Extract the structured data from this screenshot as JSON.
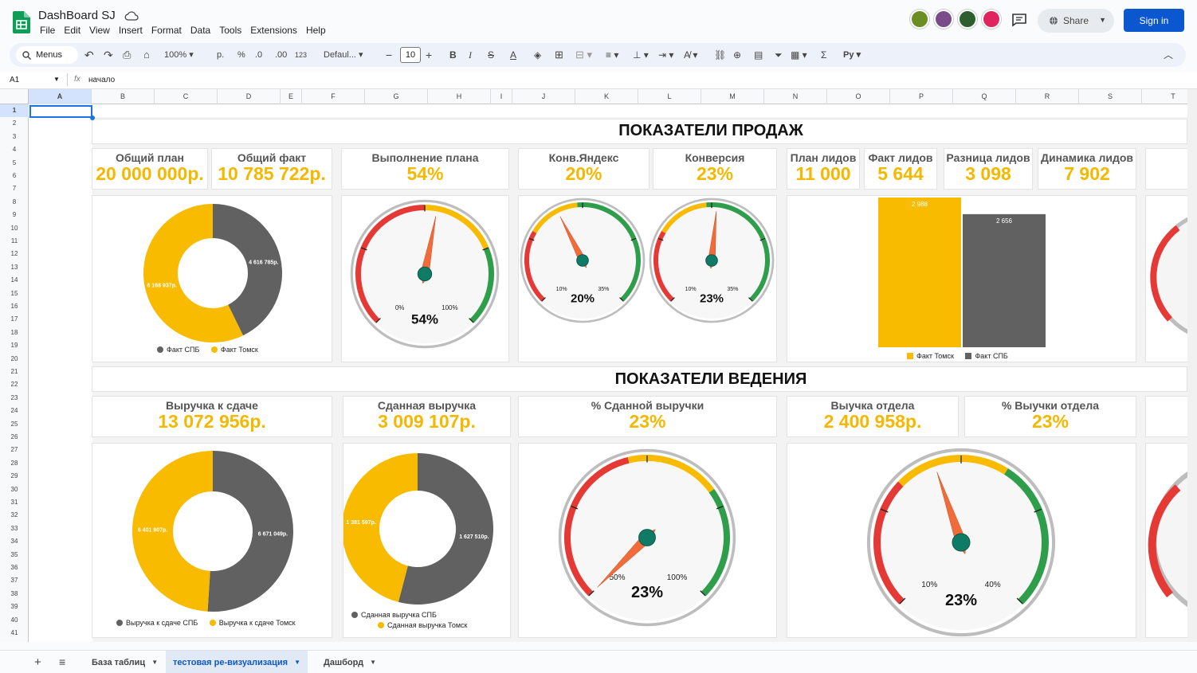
{
  "app": {
    "doc_title": "DashBoard SJ",
    "menu": [
      "File",
      "Edit",
      "View",
      "Insert",
      "Format",
      "Data",
      "Tools",
      "Extensions",
      "Help"
    ],
    "share_label": "Share",
    "signin_label": "Sign in"
  },
  "toolbar": {
    "menus_label": "Menus",
    "zoom": "100%",
    "currency": "р.",
    "percent": "%",
    "dec_less": ".0",
    "dec_more": ".00",
    "num_format": "123",
    "font": "Defaul...",
    "font_size": "10",
    "py_label": "Py"
  },
  "formula_bar": {
    "cell_ref": "A1",
    "fx": "fx",
    "value": "начало"
  },
  "columns": [
    "A",
    "B",
    "C",
    "D",
    "E",
    "F",
    "G",
    "H",
    "I",
    "J",
    "K",
    "L",
    "M",
    "N",
    "O",
    "P",
    "Q",
    "R",
    "S",
    "T"
  ],
  "rows": [
    "1",
    "2",
    "3",
    "4",
    "5",
    "6",
    "7",
    "8",
    "9",
    "10",
    "11",
    "12",
    "13",
    "14",
    "15",
    "16",
    "17",
    "18",
    "19",
    "20",
    "21",
    "22",
    "23",
    "24",
    "25",
    "26",
    "27",
    "28",
    "29",
    "30",
    "31",
    "32",
    "33",
    "34",
    "35",
    "36",
    "37",
    "38",
    "39",
    "40",
    "41"
  ],
  "dashboard": {
    "sales_title": "ПОКАЗАТЕЛИ ПРОДАЖ",
    "lead_title": "ПОКАЗАТЕЛИ ВЕДЕНИЯ",
    "kpis_top": [
      {
        "label": "Общий план",
        "value": "20 000 000р."
      },
      {
        "label": "Общий факт",
        "value": "10 785 722р."
      },
      {
        "label": "Выполнение плана",
        "value": "54%"
      },
      {
        "label": "Конв.Яндекс",
        "value": "20%"
      },
      {
        "label": "Конверсия",
        "value": "23%"
      },
      {
        "label": "План лидов",
        "value": "11 000"
      },
      {
        "label": "Факт лидов",
        "value": "5 644"
      },
      {
        "label": "Разница лидов",
        "value": "3 098"
      },
      {
        "label": "Динамика лидов",
        "value": "7 902"
      }
    ],
    "kpis_bottom": [
      {
        "label": "Выручка к сдаче",
        "value": "13 072 956р."
      },
      {
        "label": "Сданная выручка",
        "value": "3 009 107р."
      },
      {
        "label": "% Сданной выручки",
        "value": "23%"
      },
      {
        "label": "Выучка отдела",
        "value": "2 400 958р."
      },
      {
        "label": "% Выучки отдела",
        "value": "23%"
      }
    ],
    "gauges": [
      {
        "min_label": "0%",
        "max_label": "100%",
        "value_label": "54%",
        "value": 0.54
      },
      {
        "min_label": "10%",
        "max_label": "35%",
        "value_label": "20%",
        "value": 0.4
      },
      {
        "min_label": "10%",
        "max_label": "35%",
        "value_label": "23%",
        "value": 0.52
      },
      {
        "min_label": "50%",
        "max_label": "100%",
        "value_label": "23%",
        "value": 0.0
      },
      {
        "min_label": "10%",
        "max_label": "40%",
        "value_label": "23%",
        "value": 0.43
      }
    ],
    "colors": {
      "yellow": "#f8bb00",
      "grey": "#616161",
      "red": "#e53935",
      "green": "#2e9e4a",
      "needle": "#f26b3a",
      "hub": "#0f7b66"
    }
  },
  "chart_data": [
    {
      "type": "pie",
      "donut": true,
      "slices": [
        {
          "name": "Факт СПБ",
          "value": 4616785,
          "label": "4 616 785р."
        },
        {
          "name": "Факт Томск",
          "value": 6168937,
          "label": "6 168 937р."
        }
      ],
      "legend": "bottom"
    },
    {
      "type": "bar",
      "categories": [
        "Факт Томск",
        "Факт СПБ"
      ],
      "values": [
        2988,
        2656
      ],
      "value_labels": [
        "2 988",
        "2 656"
      ],
      "legend": "bottom"
    },
    {
      "type": "pie",
      "donut": true,
      "slices": [
        {
          "name": "Выручка к сдаче СПБ",
          "value": 6671049,
          "label": "6 671 049р."
        },
        {
          "name": "Выручка к сдаче Томск",
          "value": 6401907,
          "label": "6 401 907р."
        }
      ],
      "legend": "bottom"
    },
    {
      "type": "pie",
      "donut": true,
      "slices": [
        {
          "name": "Сданная выручка СПБ",
          "value": 1627510,
          "label": "1 627 510р."
        },
        {
          "name": "Сданная выручка Томск",
          "value": 1381597,
          "label": "1 381 597р."
        }
      ],
      "legend": "bottom"
    }
  ],
  "sheets": [
    {
      "label": "База таблиц"
    },
    {
      "label": "тестовая ре-визуализация"
    },
    {
      "label": "Дашборд"
    }
  ]
}
